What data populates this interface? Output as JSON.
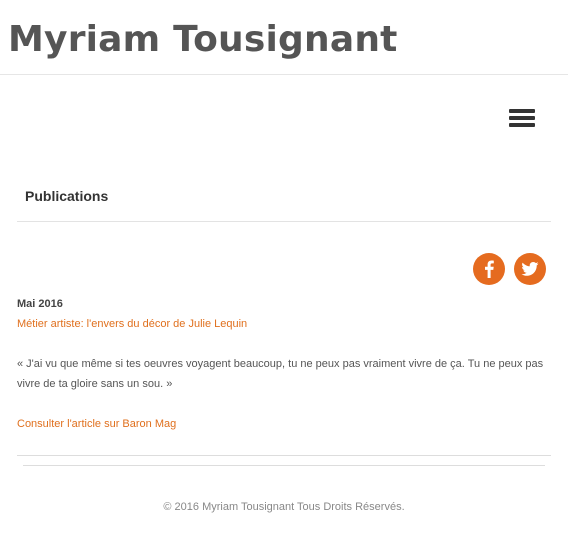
{
  "header": {
    "site_title": "Myriam Tousignant",
    "menu_icon": "hamburger-menu-icon"
  },
  "section": {
    "title": "Publications"
  },
  "social": {
    "facebook_icon": "facebook-icon",
    "twitter_icon": "twitter-icon",
    "accent_color": "#e56b1f"
  },
  "post": {
    "date": "Mai 2016",
    "title": "Métier artiste: l'envers du décor de Julie Lequin",
    "quote": "« J'ai vu que même si tes oeuvres voyagent beaucoup, tu ne peux pas vraiment vivre de ça. Tu ne peux pas vivre de ta gloire sans un sou. »",
    "read_more": "Consulter l'article sur Baron Mag"
  },
  "footer": {
    "copyright": "© 2016 Myriam Tousignant Tous Droits Réservés."
  }
}
